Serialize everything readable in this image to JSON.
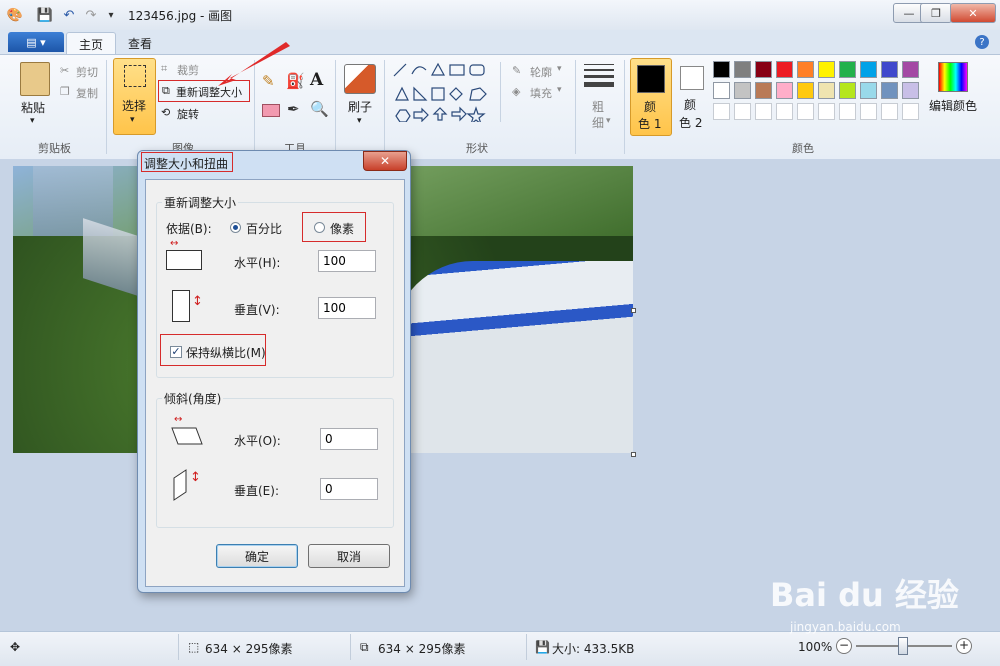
{
  "window": {
    "title": "123456.jpg - 画图",
    "minimize": "—",
    "restore": "❐",
    "close": "✕"
  },
  "ribbon": {
    "tabs": [
      {
        "label": "主页"
      },
      {
        "label": "查看"
      }
    ],
    "clipboard": {
      "paste": "粘贴",
      "cut": "剪切",
      "copy": "复制",
      "group": "剪贴板"
    },
    "image": {
      "select": "选择",
      "crop": "裁剪",
      "resize": "重新调整大小",
      "rotate": "旋转",
      "group": "图像"
    },
    "tools": {
      "group": "工具",
      "text_tool": "A"
    },
    "brush": {
      "label": "刷子"
    },
    "shapes": {
      "outline": "轮廓",
      "fill": "填充",
      "group": "形状"
    },
    "size": {
      "line1": "粗",
      "line2": "细"
    },
    "colors": {
      "color1": "颜",
      "color1b": "色 1",
      "color2": "颜",
      "color2b": "色 2",
      "group": "颜色",
      "edit": "编辑颜色",
      "palette_row1": [
        "#000000",
        "#7f7f7f",
        "#880015",
        "#ed1c24",
        "#ff7f27",
        "#fff200",
        "#22b14c",
        "#00a2e8",
        "#3f48cc",
        "#a349a4"
      ],
      "palette_row2": [
        "#ffffff",
        "#c3c3c3",
        "#b97a57",
        "#ffaec9",
        "#ffc90e",
        "#efe4b0",
        "#b5e61d",
        "#99d9ea",
        "#7092be",
        "#c8bfe7"
      ]
    }
  },
  "dialog": {
    "title": "调整大小和扭曲",
    "resize_group": "重新调整大小",
    "basis_label": "依据(B):",
    "percent_label": "百分比",
    "pixel_label": "像素",
    "horizontal_label": "水平(H):",
    "horizontal_value": "100",
    "vertical_label": "垂直(V):",
    "vertical_value": "100",
    "keep_ratio_label": "保持纵横比(M)",
    "skew_group": "倾斜(角度)",
    "skew_h_label": "水平(O):",
    "skew_h_value": "0",
    "skew_v_label": "垂直(E):",
    "skew_v_value": "0",
    "ok": "确定",
    "cancel": "取消"
  },
  "status": {
    "selection_size": "634 × 295像素",
    "image_size": "634 × 295像素",
    "file_size": "大小: 433.5KB",
    "zoom": "100%"
  },
  "watermark": {
    "text": "Bai du 经验",
    "url": "jingyan.baidu.com"
  }
}
